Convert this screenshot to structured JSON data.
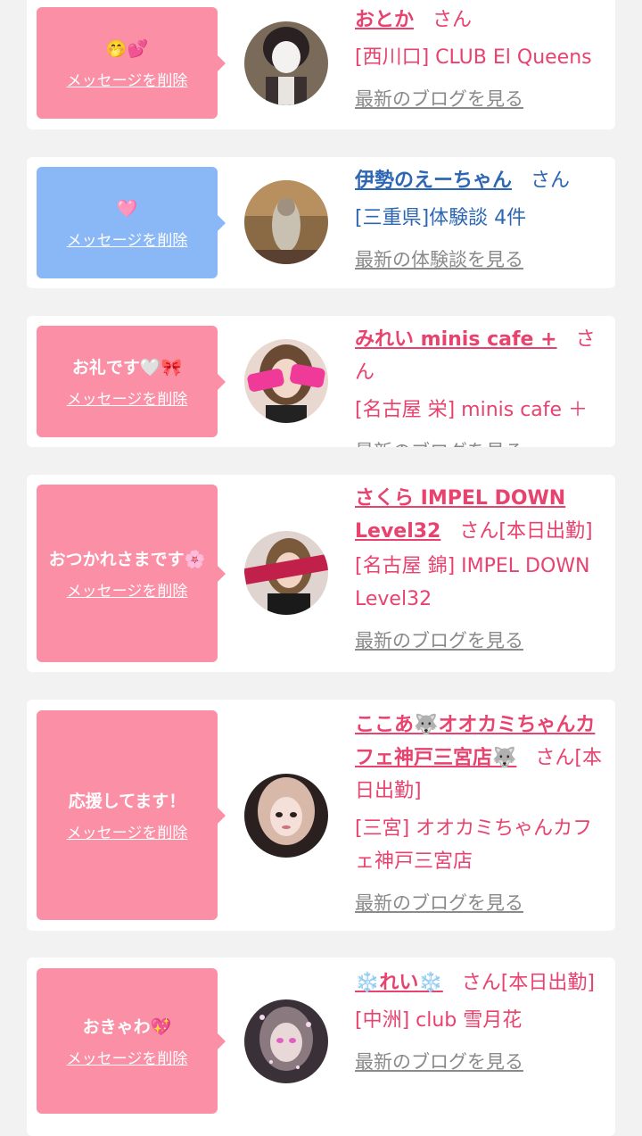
{
  "cards": [
    {
      "message": "🤭💕",
      "delete_label": "メッセージを削除",
      "name": "おとか",
      "san": "さん",
      "shop": "[西川口] CLUB El Queens",
      "blog": "最新のブログを見る"
    },
    {
      "message": "🩷",
      "delete_label": "メッセージを削除",
      "name": "伊勢のえーちゃん",
      "san": "さん",
      "shop": "[三重県]体験談 4件",
      "blog": "最新の体験談を見る"
    },
    {
      "message": "お礼です🤍🎀",
      "delete_label": "メッセージを削除",
      "name": "みれい minis cafe +",
      "san": "さん",
      "shop": "[名古屋 栄] minis cafe ＋",
      "blog": "最新のブログを見る"
    },
    {
      "message": "おつかれさまです🌸",
      "delete_label": "メッセージを削除",
      "name": "さくら IMPEL DOWN Level32",
      "san": "さん[本日出勤]",
      "shop": "[名古屋 錦] IMPEL DOWN Level32",
      "blog": "最新のブログを見る"
    },
    {
      "message": "応援してます！",
      "delete_label": "メッセージを削除",
      "name": "ここあ🐺オオカミちゃんカフェ神戸三宮店🐺",
      "san": "さん[本日出勤]",
      "shop": "[三宮] オオカミちゃんカフェ神戸三宮店",
      "blog": "最新のブログを見る"
    },
    {
      "message": "おきゃわ💖",
      "delete_label": "メッセージを削除",
      "name": "❄️れい❄️",
      "san": "さん[本日出勤]",
      "shop": "[中洲] club 雪月花",
      "blog": "最新のブログを見る"
    }
  ],
  "colors": {
    "pink_bubble": "#fa8fa6",
    "blue_bubble": "#8ab8f7",
    "pink_text": "#e8426e",
    "blue_text": "#2d67b3"
  }
}
